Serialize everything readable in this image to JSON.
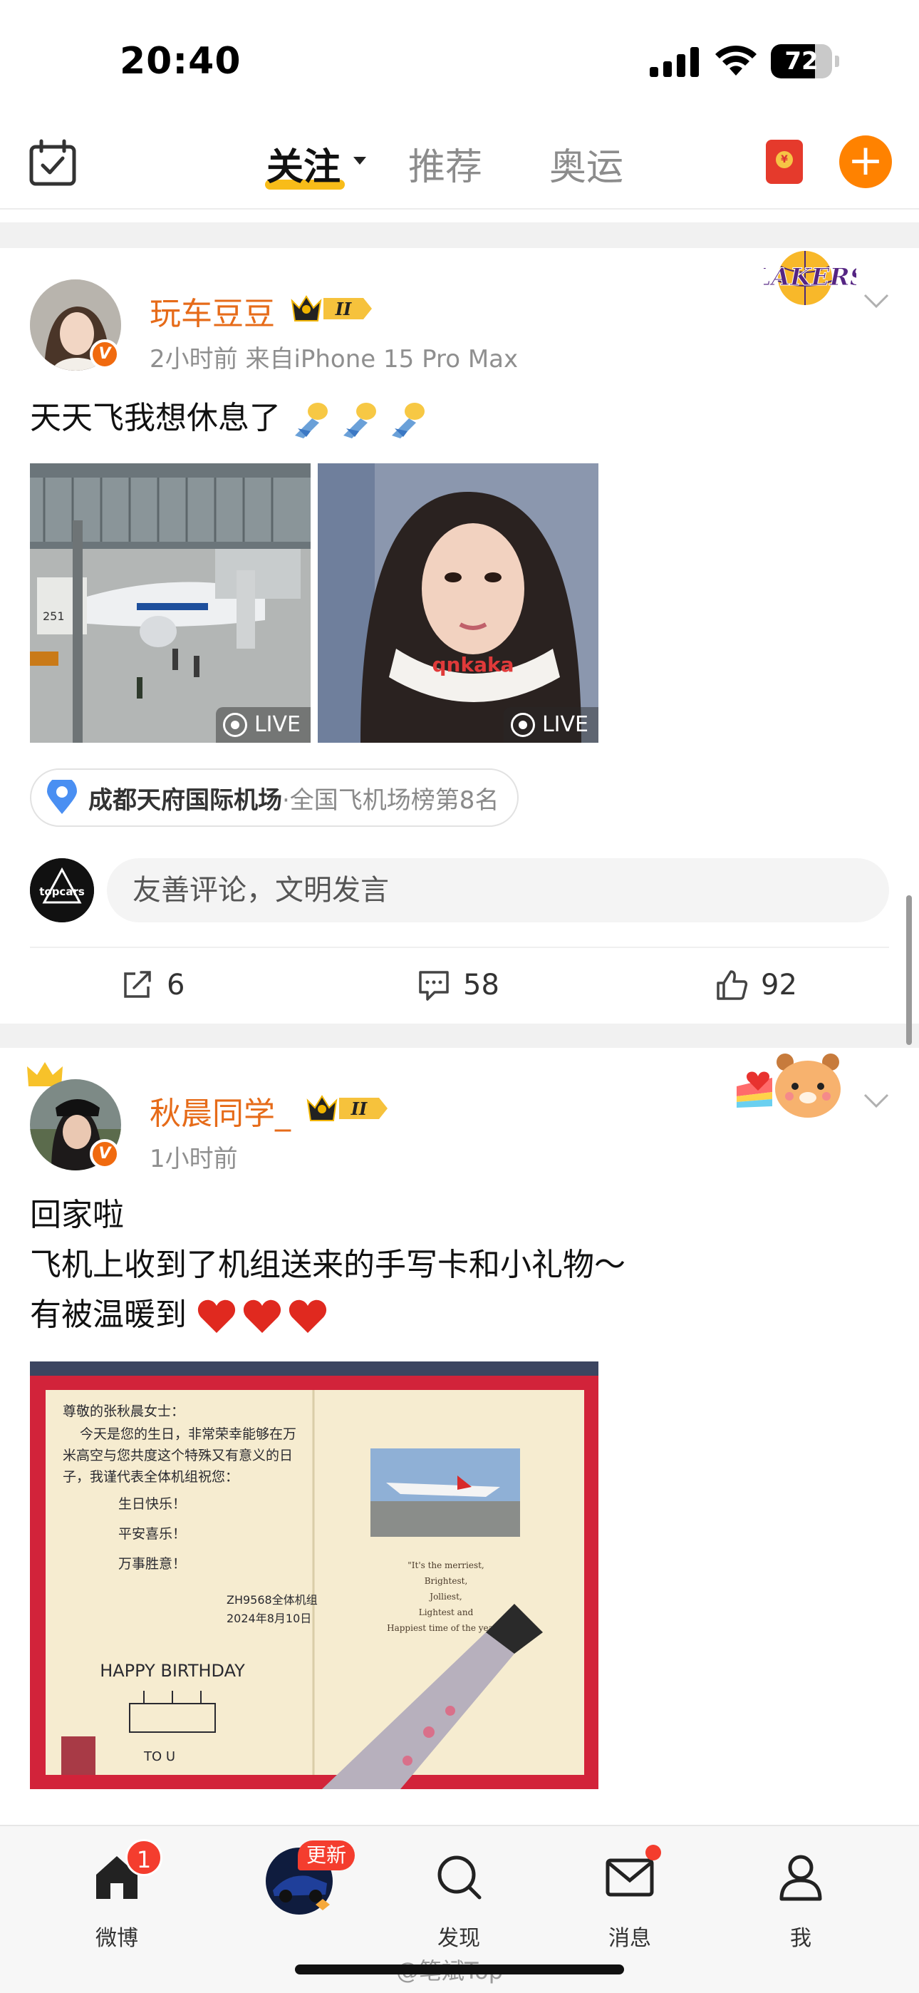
{
  "status_bar": {
    "time": "20:40",
    "battery": "72",
    "battery_level": 0.72
  },
  "top_nav": {
    "tabs": [
      {
        "label": "关注",
        "active": true
      },
      {
        "label": "推荐",
        "active": false
      },
      {
        "label": "奥运",
        "active": false
      }
    ],
    "plus_label": "+",
    "red_packet_symbol": "¥"
  },
  "posts": [
    {
      "username": "玩车豆豆",
      "vip_level": "II",
      "meta": "2小时前  来自iPhone 15 Pro Max",
      "text": "天天飞我想休息了",
      "text_emoji": [
        "airplane-emoji",
        "airplane-emoji",
        "airplane-emoji"
      ],
      "fan_badge_text": "LAKERS",
      "images": [
        {
          "live_label": "LIVE",
          "gate_label": "251"
        },
        {
          "live_label": "LIVE",
          "pillow_text": "qnkaka"
        }
      ],
      "location": {
        "name": "成都天府国际机场",
        "rank": "·全国飞机场榜第8名"
      },
      "comment_placeholder": "友善评论，文明发言",
      "commenter_avatar_text": "topcars",
      "reposts": "6",
      "comments": "58",
      "likes": "92"
    },
    {
      "username": "秋晨同学_",
      "vip_level": "II",
      "meta": "1小时前",
      "lines": [
        "回家啦",
        "飞机上收到了机组送来的手写卡和小礼物～",
        "有被温暖到"
      ],
      "hearts": 3,
      "card": {
        "handwriting": [
          "尊敬的张秋晨女士：",
          "今天是您的生日，非常荣幸能够在万",
          "米高空与您共度这个特殊又有意义的日",
          "子，我谨代表全体机组祝您：",
          "生日快乐！",
          "平安喜乐！",
          "万事胜意！",
          "ZH9568全体机组",
          "2024年8月10日"
        ],
        "printed": [
          "\"It's the merriest,",
          "Brightest,",
          "Jolliest,",
          "Lightest and",
          "Happiest time of the year!\""
        ],
        "doodle": "HAPPY BIRTHDAY",
        "doodle_sign": "TO U"
      }
    }
  ],
  "tab_bar": {
    "items": [
      {
        "label": "微博",
        "icon": "home-icon"
      },
      {
        "label": "",
        "icon": "car-icon"
      },
      {
        "label": "发现",
        "icon": "search-icon"
      },
      {
        "label": "消息",
        "icon": "mail-icon"
      },
      {
        "label": "我",
        "icon": "profile-icon"
      }
    ],
    "home_badge": "1",
    "update_badge": "更新"
  },
  "watermark": "@笔斌Top",
  "colors": {
    "accent": "#ff8200",
    "username": "#e66b19",
    "badge_red": "#f43d2e"
  }
}
